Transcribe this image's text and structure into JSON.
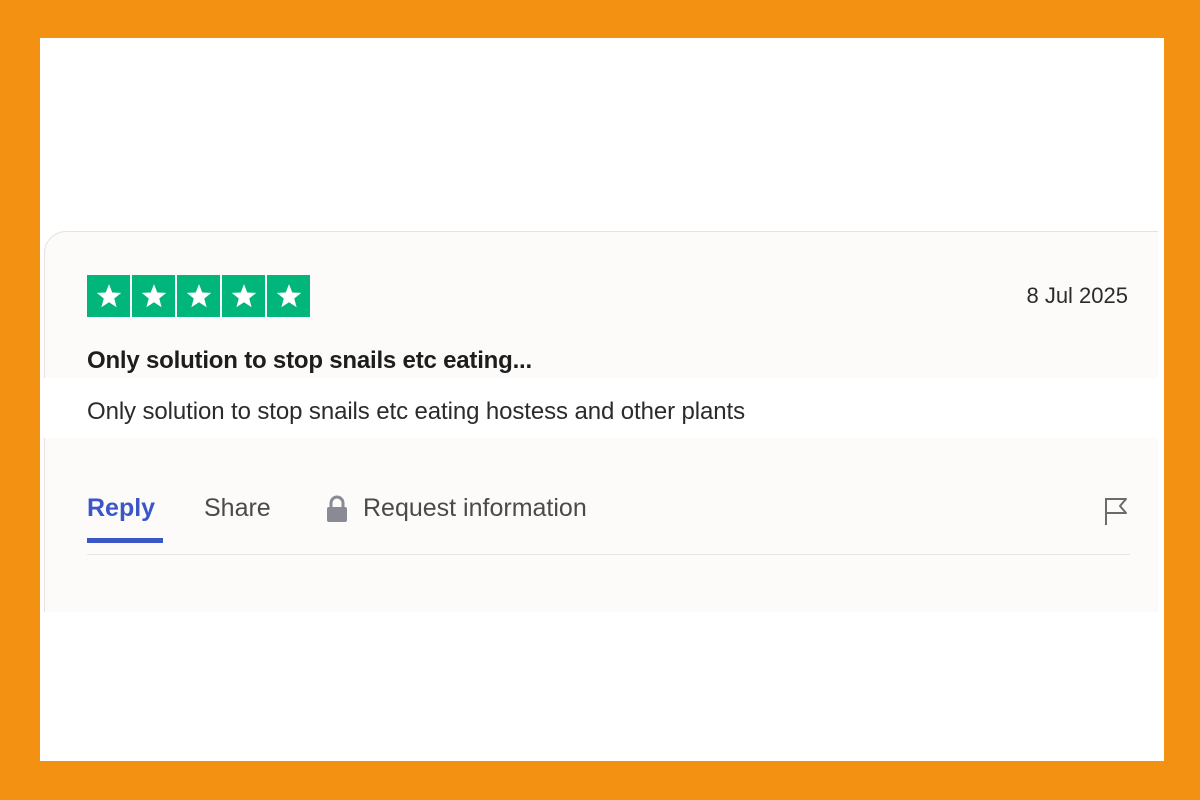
{
  "colors": {
    "frame": "#f39212",
    "star_bg": "#00b67a",
    "accent": "#3b57c7"
  },
  "review": {
    "rating": 5,
    "rating_max": 5,
    "date": "8 Jul 2025",
    "title": "Only solution to stop snails etc eating...",
    "body": "Only solution to stop snails etc eating hostess and other plants"
  },
  "actions": {
    "reply_label": "Reply",
    "share_label": "Share",
    "request_label": "Request information",
    "request_icon": "lock-icon",
    "flag_icon": "flag-icon"
  }
}
